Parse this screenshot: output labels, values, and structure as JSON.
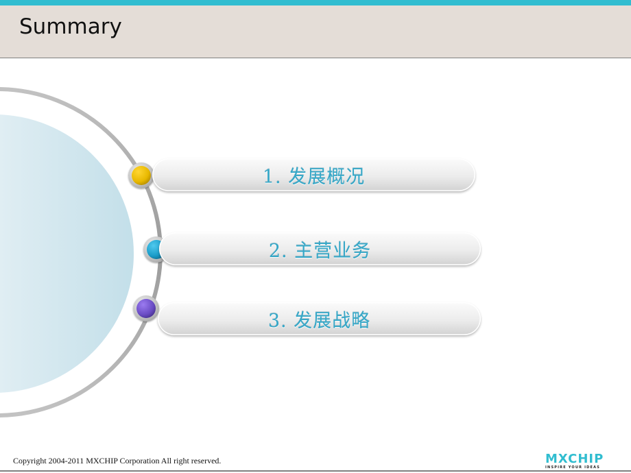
{
  "header": {
    "title": "Summary"
  },
  "agenda": {
    "items": [
      {
        "label": "1.  发展概况",
        "bullet_color": "yellow"
      },
      {
        "label": "2.  主营业务",
        "bullet_color": "blue"
      },
      {
        "label": "3.  发展战略",
        "bullet_color": "purple"
      }
    ]
  },
  "colors": {
    "accent": "#31bdd0",
    "header_bg": "#e4ddd7",
    "item_text": "#35a7c7",
    "bullet_yellow": "#e8b800",
    "bullet_blue": "#1a9cc9",
    "bullet_purple": "#6a4cc4"
  },
  "footer": {
    "copyright": "Copyright 2004-2011  MXCHIP Corporation All right reserved.",
    "logo_word": "MXCHIP",
    "logo_tagline": "INSPIRE YOUR IDEAS"
  }
}
